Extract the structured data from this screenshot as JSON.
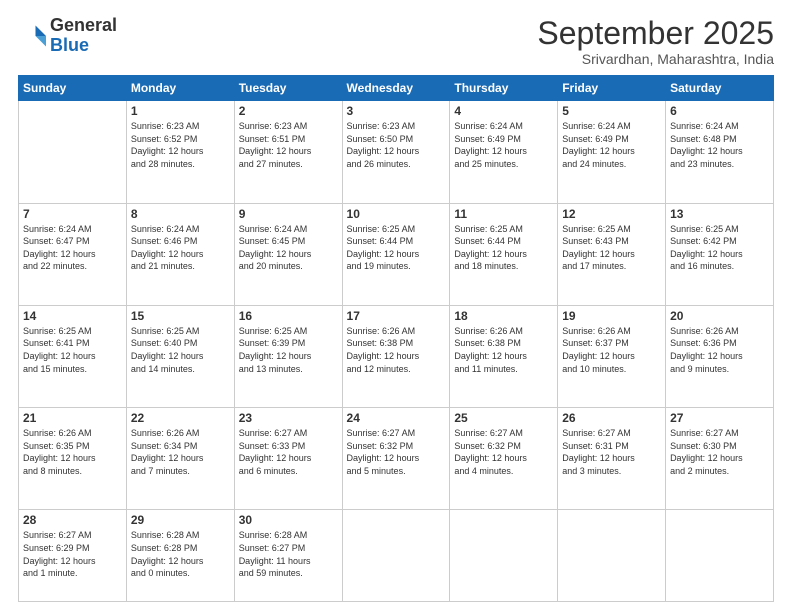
{
  "logo": {
    "general": "General",
    "blue": "Blue"
  },
  "title": "September 2025",
  "subtitle": "Srivardhan, Maharashtra, India",
  "days": [
    "Sunday",
    "Monday",
    "Tuesday",
    "Wednesday",
    "Thursday",
    "Friday",
    "Saturday"
  ],
  "weeks": [
    [
      {
        "num": "",
        "lines": []
      },
      {
        "num": "1",
        "lines": [
          "Sunrise: 6:23 AM",
          "Sunset: 6:52 PM",
          "Daylight: 12 hours",
          "and 28 minutes."
        ]
      },
      {
        "num": "2",
        "lines": [
          "Sunrise: 6:23 AM",
          "Sunset: 6:51 PM",
          "Daylight: 12 hours",
          "and 27 minutes."
        ]
      },
      {
        "num": "3",
        "lines": [
          "Sunrise: 6:23 AM",
          "Sunset: 6:50 PM",
          "Daylight: 12 hours",
          "and 26 minutes."
        ]
      },
      {
        "num": "4",
        "lines": [
          "Sunrise: 6:24 AM",
          "Sunset: 6:49 PM",
          "Daylight: 12 hours",
          "and 25 minutes."
        ]
      },
      {
        "num": "5",
        "lines": [
          "Sunrise: 6:24 AM",
          "Sunset: 6:49 PM",
          "Daylight: 12 hours",
          "and 24 minutes."
        ]
      },
      {
        "num": "6",
        "lines": [
          "Sunrise: 6:24 AM",
          "Sunset: 6:48 PM",
          "Daylight: 12 hours",
          "and 23 minutes."
        ]
      }
    ],
    [
      {
        "num": "7",
        "lines": [
          "Sunrise: 6:24 AM",
          "Sunset: 6:47 PM",
          "Daylight: 12 hours",
          "and 22 minutes."
        ]
      },
      {
        "num": "8",
        "lines": [
          "Sunrise: 6:24 AM",
          "Sunset: 6:46 PM",
          "Daylight: 12 hours",
          "and 21 minutes."
        ]
      },
      {
        "num": "9",
        "lines": [
          "Sunrise: 6:24 AM",
          "Sunset: 6:45 PM",
          "Daylight: 12 hours",
          "and 20 minutes."
        ]
      },
      {
        "num": "10",
        "lines": [
          "Sunrise: 6:25 AM",
          "Sunset: 6:44 PM",
          "Daylight: 12 hours",
          "and 19 minutes."
        ]
      },
      {
        "num": "11",
        "lines": [
          "Sunrise: 6:25 AM",
          "Sunset: 6:44 PM",
          "Daylight: 12 hours",
          "and 18 minutes."
        ]
      },
      {
        "num": "12",
        "lines": [
          "Sunrise: 6:25 AM",
          "Sunset: 6:43 PM",
          "Daylight: 12 hours",
          "and 17 minutes."
        ]
      },
      {
        "num": "13",
        "lines": [
          "Sunrise: 6:25 AM",
          "Sunset: 6:42 PM",
          "Daylight: 12 hours",
          "and 16 minutes."
        ]
      }
    ],
    [
      {
        "num": "14",
        "lines": [
          "Sunrise: 6:25 AM",
          "Sunset: 6:41 PM",
          "Daylight: 12 hours",
          "and 15 minutes."
        ]
      },
      {
        "num": "15",
        "lines": [
          "Sunrise: 6:25 AM",
          "Sunset: 6:40 PM",
          "Daylight: 12 hours",
          "and 14 minutes."
        ]
      },
      {
        "num": "16",
        "lines": [
          "Sunrise: 6:25 AM",
          "Sunset: 6:39 PM",
          "Daylight: 12 hours",
          "and 13 minutes."
        ]
      },
      {
        "num": "17",
        "lines": [
          "Sunrise: 6:26 AM",
          "Sunset: 6:38 PM",
          "Daylight: 12 hours",
          "and 12 minutes."
        ]
      },
      {
        "num": "18",
        "lines": [
          "Sunrise: 6:26 AM",
          "Sunset: 6:38 PM",
          "Daylight: 12 hours",
          "and 11 minutes."
        ]
      },
      {
        "num": "19",
        "lines": [
          "Sunrise: 6:26 AM",
          "Sunset: 6:37 PM",
          "Daylight: 12 hours",
          "and 10 minutes."
        ]
      },
      {
        "num": "20",
        "lines": [
          "Sunrise: 6:26 AM",
          "Sunset: 6:36 PM",
          "Daylight: 12 hours",
          "and 9 minutes."
        ]
      }
    ],
    [
      {
        "num": "21",
        "lines": [
          "Sunrise: 6:26 AM",
          "Sunset: 6:35 PM",
          "Daylight: 12 hours",
          "and 8 minutes."
        ]
      },
      {
        "num": "22",
        "lines": [
          "Sunrise: 6:26 AM",
          "Sunset: 6:34 PM",
          "Daylight: 12 hours",
          "and 7 minutes."
        ]
      },
      {
        "num": "23",
        "lines": [
          "Sunrise: 6:27 AM",
          "Sunset: 6:33 PM",
          "Daylight: 12 hours",
          "and 6 minutes."
        ]
      },
      {
        "num": "24",
        "lines": [
          "Sunrise: 6:27 AM",
          "Sunset: 6:32 PM",
          "Daylight: 12 hours",
          "and 5 minutes."
        ]
      },
      {
        "num": "25",
        "lines": [
          "Sunrise: 6:27 AM",
          "Sunset: 6:32 PM",
          "Daylight: 12 hours",
          "and 4 minutes."
        ]
      },
      {
        "num": "26",
        "lines": [
          "Sunrise: 6:27 AM",
          "Sunset: 6:31 PM",
          "Daylight: 12 hours",
          "and 3 minutes."
        ]
      },
      {
        "num": "27",
        "lines": [
          "Sunrise: 6:27 AM",
          "Sunset: 6:30 PM",
          "Daylight: 12 hours",
          "and 2 minutes."
        ]
      }
    ],
    [
      {
        "num": "28",
        "lines": [
          "Sunrise: 6:27 AM",
          "Sunset: 6:29 PM",
          "Daylight: 12 hours",
          "and 1 minute."
        ]
      },
      {
        "num": "29",
        "lines": [
          "Sunrise: 6:28 AM",
          "Sunset: 6:28 PM",
          "Daylight: 12 hours",
          "and 0 minutes."
        ]
      },
      {
        "num": "30",
        "lines": [
          "Sunrise: 6:28 AM",
          "Sunset: 6:27 PM",
          "Daylight: 11 hours",
          "and 59 minutes."
        ]
      },
      {
        "num": "",
        "lines": []
      },
      {
        "num": "",
        "lines": []
      },
      {
        "num": "",
        "lines": []
      },
      {
        "num": "",
        "lines": []
      }
    ]
  ]
}
